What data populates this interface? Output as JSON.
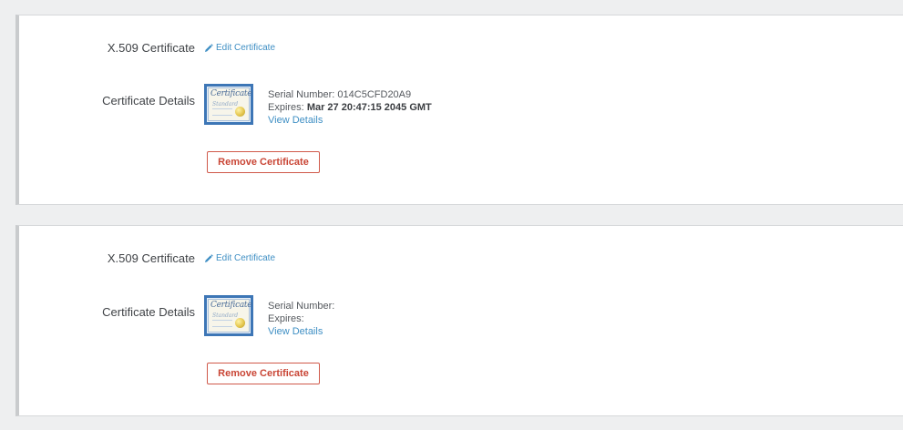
{
  "colors": {
    "link": "#3f8fc4",
    "danger": "#c94535",
    "panel_border_left": "#c9cbcd",
    "background": "#eeeff0"
  },
  "certificates": [
    {
      "section_label": "X.509 Certificate",
      "edit_icon": "pencil-icon",
      "edit_label": "Edit Certificate",
      "details_label": "Certificate Details",
      "thumbnail": {
        "title": "Certificate",
        "subtitle": "Standard"
      },
      "serial_label": "Serial Number:",
      "serial_value": "014C5CFD20A9",
      "expires_label": "Expires:",
      "expires_value": "Mar 27 20:47:15 2045 GMT",
      "view_details_label": "View Details",
      "remove_label": "Remove Certificate"
    },
    {
      "section_label": "X.509 Certificate",
      "edit_icon": "pencil-icon",
      "edit_label": "Edit Certificate",
      "details_label": "Certificate Details",
      "thumbnail": {
        "title": "Certificate",
        "subtitle": "Standard"
      },
      "serial_label": "Serial Number:",
      "serial_value": "",
      "expires_label": "Expires:",
      "expires_value": "",
      "view_details_label": "View Details",
      "remove_label": "Remove Certificate"
    }
  ]
}
